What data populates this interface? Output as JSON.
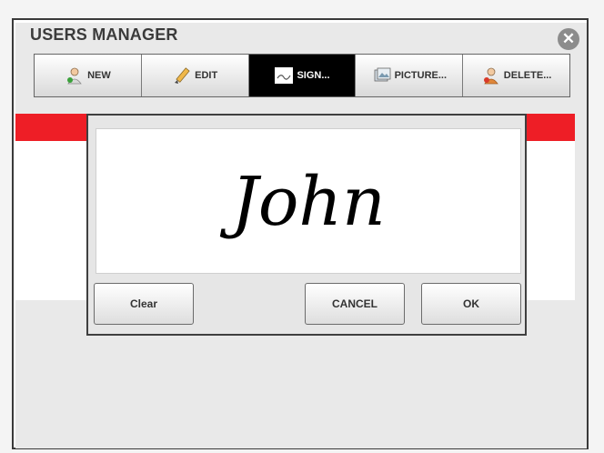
{
  "window": {
    "title": "USERS MANAGER",
    "close_icon": "close-icon"
  },
  "toolbar": {
    "buttons": [
      {
        "label": "NEW",
        "icon": "user-add-icon"
      },
      {
        "label": "EDIT",
        "icon": "pencil-icon"
      },
      {
        "label": "SIGN...",
        "icon": "signature-icon",
        "active": true
      },
      {
        "label": "PICTURE...",
        "icon": "picture-icon"
      },
      {
        "label": "DELETE...",
        "icon": "user-delete-icon"
      }
    ]
  },
  "signature_dialog": {
    "signature_text": "John",
    "clear_label": "Clear",
    "cancel_label": "CANCEL",
    "ok_label": "OK"
  },
  "colors": {
    "accent_red": "#ee1e26",
    "active_tab": "#000000",
    "panel_bg": "#e9e9e9"
  }
}
